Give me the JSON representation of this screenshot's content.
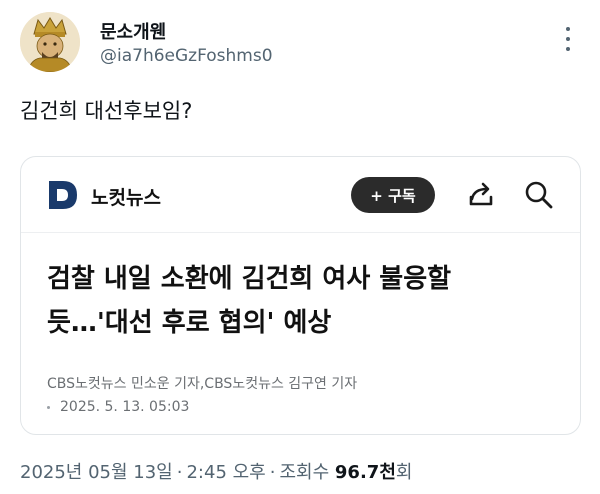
{
  "author": {
    "display_name": "문소개웬",
    "handle": "@ia7h6eGzFoshms0"
  },
  "tweet": {
    "text": "김건희 대선후보임?"
  },
  "card": {
    "site_name": "노컷뉴스",
    "subscribe_label": "+ 구독",
    "headline_line1": "검찰 내일 소환에 김건희 여사 불응할",
    "headline_line2": "듯…'대선 후로 협의' 예상",
    "byline": "CBS노컷뉴스 민소운 기자,CBS노컷뉴스 김구연 기자",
    "date": "2025. 5. 13. 05:03",
    "brand_color": "#1a3a6b"
  },
  "meta": {
    "date": "2025년 05월 13일",
    "time": "2:45 오후",
    "views_label": "조회수",
    "views_number": "96.7천",
    "views_suffix": "회"
  }
}
